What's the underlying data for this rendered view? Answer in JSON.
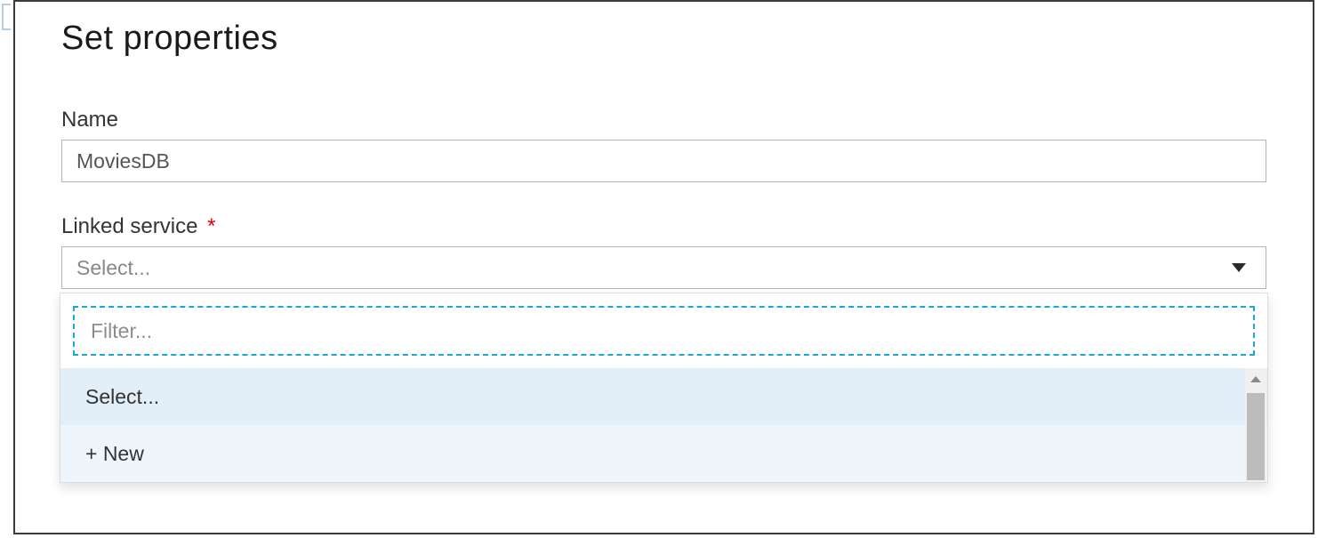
{
  "header": {
    "title": "Set properties"
  },
  "fields": {
    "name": {
      "label": "Name",
      "value": "MoviesDB"
    },
    "linked_service": {
      "label": "Linked service",
      "required_marker": "*",
      "placeholder": "Select..."
    }
  },
  "dropdown": {
    "filter_placeholder": "Filter...",
    "options": [
      {
        "label": "Select..."
      },
      {
        "label": "+ New"
      }
    ]
  }
}
